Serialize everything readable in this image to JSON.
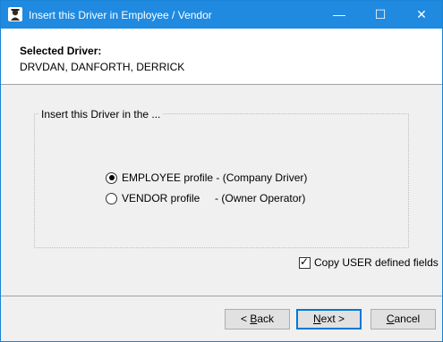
{
  "window": {
    "title": "Insert this Driver in Employee / Vendor",
    "controls": {
      "minimize": "—",
      "maximize": "☐",
      "close": "✕"
    },
    "icon": "driver-person-icon"
  },
  "header": {
    "selected_label": "Selected Driver:",
    "selected_value": "DRVDAN, DANFORTH, DERRICK"
  },
  "group": {
    "legend": "Insert this Driver in the ...",
    "options": [
      {
        "label": "EMPLOYEE profile - (Company Driver)",
        "selected": true
      },
      {
        "label": "VENDOR profile     - (Owner Operator)",
        "selected": false
      }
    ]
  },
  "copy_user_fields": {
    "label": "Copy USER defined fields",
    "checked": true
  },
  "buttons": {
    "back": {
      "prefix": "< ",
      "mnemonic": "B",
      "rest": "ack"
    },
    "next": {
      "mnemonic": "N",
      "rest": "ext >"
    },
    "cancel": {
      "mnemonic": "C",
      "rest": "ancel"
    }
  },
  "colors": {
    "titlebar": "#1f8ae0",
    "window_bg": "#f0f0f0",
    "panel_bg": "#ffffff",
    "accent": "#0078d7"
  }
}
